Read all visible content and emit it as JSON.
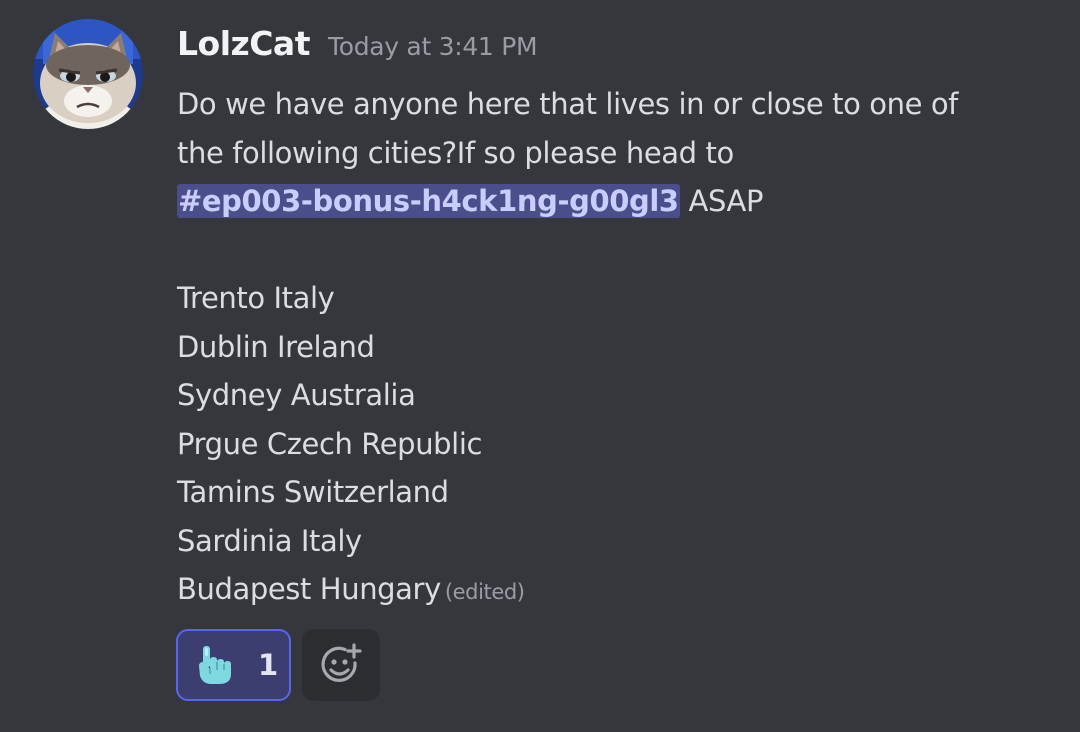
{
  "message": {
    "username": "LolzCat",
    "timestamp": "Today at 3:41 PM",
    "text_line_1": "Do we have anyone here that lives in or close to one of",
    "text_line_2": "the following cities?If so please head to",
    "channel_mention": "#ep003-bonus-h4ck1ng-g00gl3",
    "after_mention": "ASAP",
    "cities": [
      "Trento Italy",
      "Dublin Ireland",
      "Sydney Australia",
      "Prgue Czech Republic",
      "Tamins Switzerland",
      "Sardinia Italy",
      "Budapest Hungary"
    ],
    "edited_label": "(edited)"
  },
  "reactions": [
    {
      "emoji": "pointing-hand-icon",
      "count": "1",
      "selected": true
    }
  ],
  "add_reaction": {
    "icon": "add-emoji-icon"
  },
  "colors": {
    "background": "#36373d",
    "mention_bg": "#4a4e8a",
    "mention_text": "#c9cdfb",
    "reaction_border": "#5865f2",
    "reaction_bg": "#3b3e6e"
  }
}
